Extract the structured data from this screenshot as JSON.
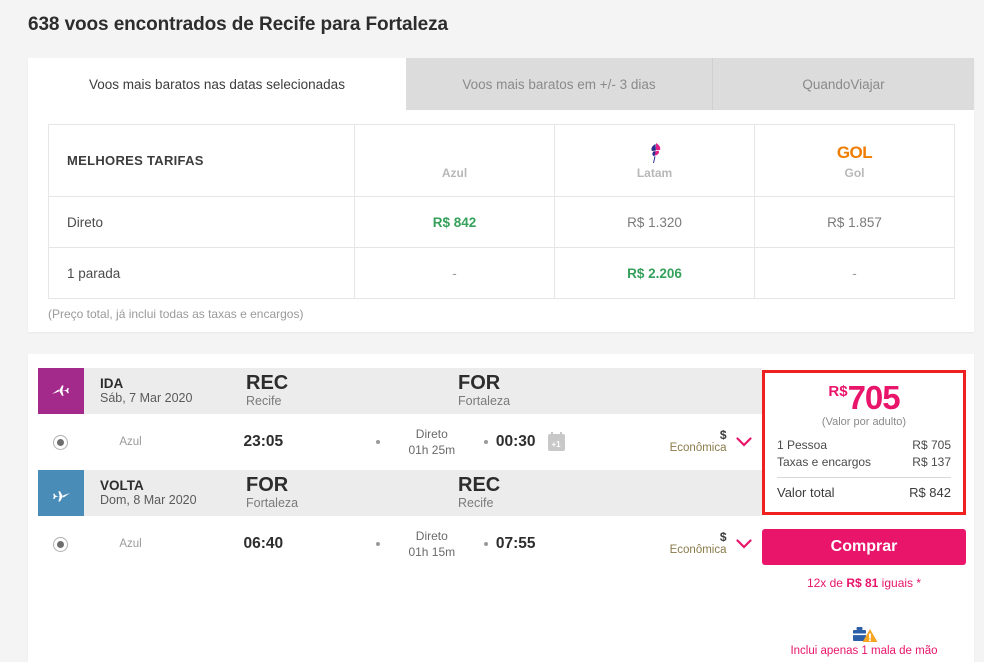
{
  "header": {
    "title": "638 voos encontrados de Recife para Fortaleza"
  },
  "tabs": [
    {
      "label": "Voos mais baratos nas datas selecionadas",
      "active": true
    },
    {
      "label": "Voos mais baratos em +/- 3 dias",
      "active": false
    },
    {
      "label": "QuandoViajar",
      "active": false
    }
  ],
  "fare_table": {
    "corner_header": "MELHORES TARIFAS",
    "airlines": [
      {
        "name": "Azul",
        "logo": "azul-logo"
      },
      {
        "name": "Latam",
        "logo": "latam-logo"
      },
      {
        "name": "Gol",
        "logo": "gol-logo",
        "wordmark": "GOL"
      }
    ],
    "rows": [
      {
        "label": "Direto",
        "cells": [
          "R$ 842",
          "R$ 1.320",
          "R$ 1.857"
        ]
      },
      {
        "label": "1 parada",
        "cells": [
          "-",
          "R$ 2.206",
          "-"
        ]
      }
    ],
    "best_cells": [
      "0-0",
      "1-1"
    ],
    "note": "(Preço total, já inclui todas as taxas e encargos)"
  },
  "result": {
    "legs": [
      {
        "direction": "IDA",
        "date": "Sáb, 7 Mar 2020",
        "origin_code": "REC",
        "origin_city": "Recife",
        "destination_code": "FOR",
        "destination_city": "Fortaleza",
        "carrier": "Azul",
        "depart_time": "23:05",
        "arrive_time": "00:30",
        "next_day_badge": "+1",
        "stops": "Direto",
        "duration": "01h 25m",
        "fare_class": "Econômica",
        "fare_class_symbol": "$"
      },
      {
        "direction": "VOLTA",
        "date": "Dom, 8 Mar 2020",
        "origin_code": "FOR",
        "origin_city": "Fortaleza",
        "destination_code": "REC",
        "destination_city": "Recife",
        "carrier": "Azul",
        "depart_time": "06:40",
        "arrive_time": "07:55",
        "next_day_badge": "",
        "stops": "Direto",
        "duration": "01h 15m",
        "fare_class": "Econômica",
        "fare_class_symbol": "$"
      }
    ],
    "price": {
      "currency": "R$",
      "amount": "705",
      "per_adult_note": "(Valor por adulto)",
      "breakdown": [
        {
          "label": "1 Pessoa",
          "value": "R$ 705"
        },
        {
          "label": "Taxas e encargos",
          "value": "R$ 137"
        }
      ],
      "total_label": "Valor total",
      "total_value": "R$ 842",
      "buy_label": "Comprar",
      "installments_prefix": "12x de ",
      "installments_amount": "R$ 81",
      "installments_suffix": " iguais *",
      "baggage_text": "Inclui apenas 1 mala de mão"
    }
  },
  "colors": {
    "accent_pink": "#e8156b",
    "highlight_red": "#ef2020",
    "best_fare_green": "#35a15a",
    "outbound_badge": "#a32a8a",
    "return_badge": "#4a8cb8",
    "gol_orange": "#f07d00"
  }
}
